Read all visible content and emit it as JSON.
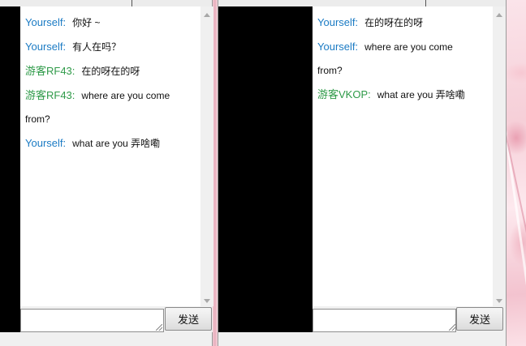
{
  "left_window": {
    "send_label": "发送",
    "messages": [
      {
        "sender": "Yourself",
        "role": "self",
        "colon": ":",
        "text": "你好 ~"
      },
      {
        "sender": "Yourself",
        "role": "self",
        "colon": ":",
        "text": "有人在吗？"
      },
      {
        "sender": "游客RF43",
        "role": "guest",
        "colon": ":",
        "text": "在的呀在的呀"
      },
      {
        "sender": "游客RF43",
        "role": "guest",
        "colon": ":",
        "text": "where are you come from?"
      },
      {
        "sender": "Yourself",
        "role": "self",
        "colon": ":",
        "text": "what are you 弄啥嘞"
      }
    ]
  },
  "right_window": {
    "send_label": "发送",
    "messages": [
      {
        "sender": "Yourself",
        "role": "self",
        "colon": ":",
        "text": "在的呀在的呀"
      },
      {
        "sender": "Yourself",
        "role": "self",
        "colon": ":",
        "text": "where are you come from?"
      },
      {
        "sender": "游客VKOP",
        "role": "guest",
        "colon": ":",
        "text": "what are you 弄啥嘞"
      }
    ]
  },
  "colors": {
    "self_name": "#1b7bc4",
    "guest_name": "#2e9a48",
    "video_pane": "#000000"
  }
}
